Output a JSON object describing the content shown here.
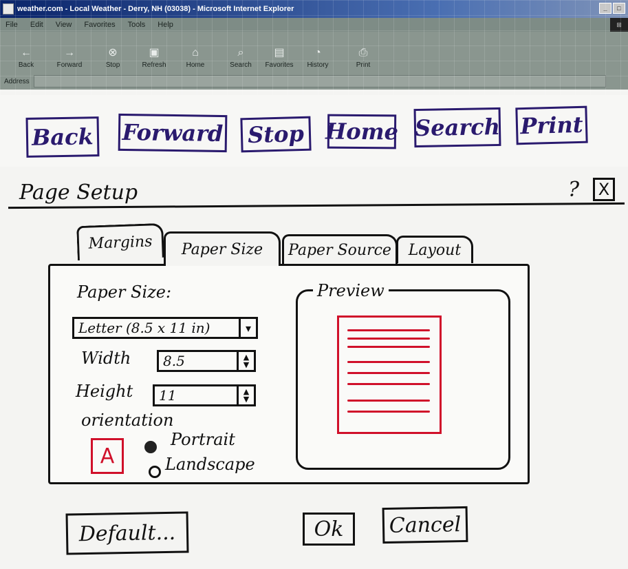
{
  "browser": {
    "title": "weather.com - Local Weather - Derry, NH (03038) - Microsoft Internet Explorer",
    "menus": [
      "File",
      "Edit",
      "View",
      "Favorites",
      "Tools",
      "Help"
    ],
    "toolbar": [
      "Back",
      "Forward",
      "Stop",
      "Refresh",
      "Home",
      "Search",
      "Favorites",
      "History",
      "Print"
    ],
    "address_label": "Address"
  },
  "prototype_nav": [
    "Back",
    "Forward",
    "Stop",
    "Home",
    "Search",
    "Print"
  ],
  "dialog": {
    "title": "Page Setup",
    "help": "?",
    "close": "X",
    "tabs": [
      "Margins",
      "Paper Size",
      "Paper Source",
      "Layout"
    ],
    "active_tab": "Paper Size",
    "paper_size_label": "Paper Size:",
    "paper_size_value": "Letter (8.5 x 11 in)",
    "width_label": "Width",
    "width_value": "8.5",
    "height_label": "Height",
    "height_value": "11",
    "orientation_label": "orientation",
    "orientation_icon": "A",
    "orientation_options": [
      "Portrait",
      "Landscape"
    ],
    "orientation_selected": "Portrait",
    "preview_label": "Preview",
    "buttons": {
      "default": "Default...",
      "ok": "Ok",
      "cancel": "Cancel"
    }
  },
  "colors": {
    "ink": "#111111",
    "nav_ink": "#2a1a6e",
    "red_ink": "#d0102a"
  }
}
